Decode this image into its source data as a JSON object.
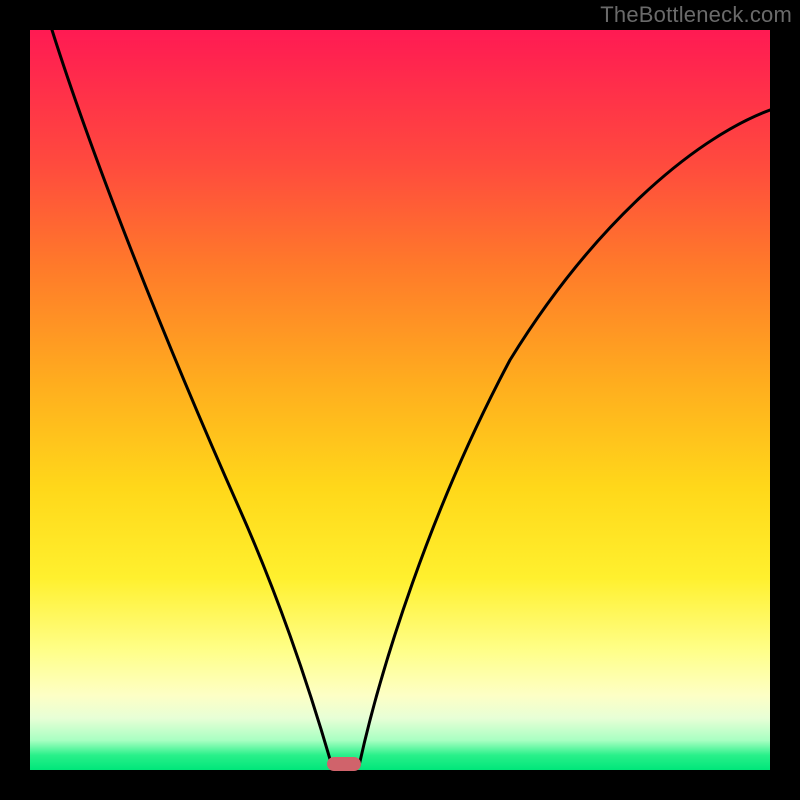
{
  "watermark": {
    "text": "TheBottleneck.com"
  },
  "chart_data": {
    "type": "line",
    "title": "",
    "xlabel": "",
    "ylabel": "",
    "xlim": [
      0,
      100
    ],
    "ylim": [
      0,
      100
    ],
    "grid": false,
    "legend": false,
    "series": [
      {
        "name": "left-curve",
        "x": [
          3,
          6,
          10,
          15,
          20,
          25,
          30,
          33,
          36,
          38,
          39.5,
          40.8
        ],
        "y": [
          100,
          90,
          78,
          63,
          50,
          38,
          26,
          18,
          11,
          6,
          2.5,
          0.5
        ]
      },
      {
        "name": "right-curve",
        "x": [
          44.5,
          46,
          48,
          51,
          55,
          60,
          66,
          73,
          81,
          90,
          100
        ],
        "y": [
          0.5,
          4,
          10,
          18,
          28,
          40,
          52,
          63,
          73,
          82,
          89
        ]
      }
    ],
    "marker": {
      "name": "bottleneck-marker",
      "x_center": 42.5,
      "y": 0,
      "width_pct": 4.6,
      "color": "#d0636b"
    },
    "gradient_stops": [
      {
        "pos": 0.0,
        "color": "#ff1a53"
      },
      {
        "pos": 0.48,
        "color": "#ffae1e"
      },
      {
        "pos": 0.84,
        "color": "#ffff8a"
      },
      {
        "pos": 0.96,
        "color": "#a8ffc2"
      },
      {
        "pos": 1.0,
        "color": "#00e67a"
      }
    ]
  }
}
